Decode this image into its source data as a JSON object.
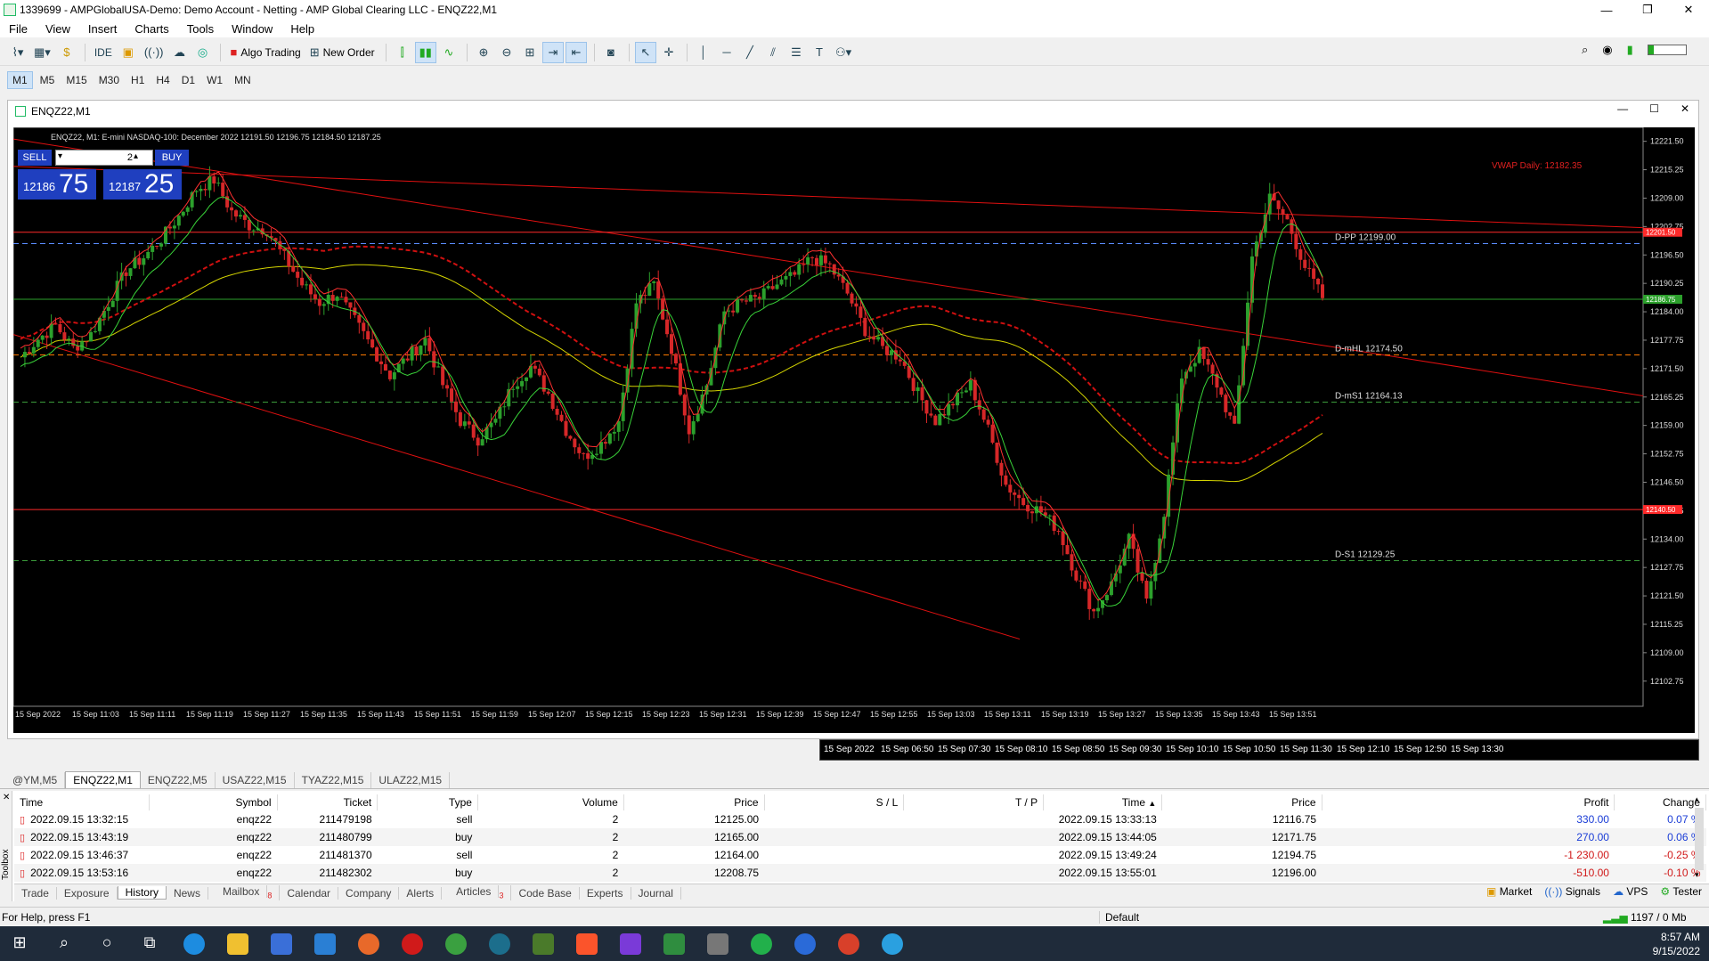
{
  "window": {
    "title": "1339699 - AMPGlobalUSA-Demo: Demo Account - Netting - AMP Global Clearing LLC - ENQZ22,M1",
    "minimize": "—",
    "restore": "❐",
    "close": "✕"
  },
  "menu": [
    "File",
    "View",
    "Insert",
    "Charts",
    "Tools",
    "Window",
    "Help"
  ],
  "toolbar": {
    "ide": "IDE",
    "algo_trading": "Algo Trading",
    "new_order": "New Order"
  },
  "timeframes": [
    "M1",
    "M5",
    "M15",
    "M30",
    "H1",
    "H4",
    "D1",
    "W1",
    "MN"
  ],
  "chart_window": {
    "title": "ENQZ22,M1",
    "header_text": "ENQZ22, M1: E-mini NASDAQ-100: December 2022  12191.50 12196.75 12184.50 12187.25"
  },
  "trade_panel": {
    "sell_label": "SELL",
    "buy_label": "BUY",
    "volume": "2",
    "sell_price_small": "12186",
    "sell_price_big": "75",
    "buy_price_small": "12187",
    "buy_price_big": "25"
  },
  "chart_data": {
    "type": "candlestick",
    "symbol": "ENQZ22",
    "timeframe": "M1",
    "ylim": [
      12098,
      12223
    ],
    "y_ticks": [
      12221.5,
      12215.25,
      12209.0,
      12202.75,
      12196.5,
      12190.25,
      12184.0,
      12177.75,
      12171.5,
      12165.25,
      12159.0,
      12152.75,
      12146.5,
      12140.25,
      12134.0,
      12127.75,
      12121.5,
      12115.25,
      12109.0,
      12102.75
    ],
    "y_tick_labels": [
      "12221.50",
      "12215.25",
      "12209.00",
      "12202.75",
      "12196.50",
      "12190.25",
      "12184.00",
      "12177.75",
      "12171.50",
      "12165.25",
      "12159.00",
      "12152.75",
      "12146.50",
      "12140.25",
      "12134.00",
      "12127.75",
      "12121.50",
      "12115.25",
      "12109.00",
      "12102.75"
    ],
    "x_tick_labels": [
      "15 Sep 2022",
      "15 Sep 11:03",
      "15 Sep 11:11",
      "15 Sep 11:19",
      "15 Sep 11:27",
      "15 Sep 11:35",
      "15 Sep 11:43",
      "15 Sep 11:51",
      "15 Sep 11:59",
      "15 Sep 12:07",
      "15 Sep 12:15",
      "15 Sep 12:23",
      "15 Sep 12:31",
      "15 Sep 12:39",
      "15 Sep 12:47",
      "15 Sep 12:55",
      "15 Sep 13:03",
      "15 Sep 13:11",
      "15 Sep 13:19",
      "15 Sep 13:27",
      "15 Sep 13:35",
      "15 Sep 13:43",
      "15 Sep 13:51"
    ],
    "close_path": [
      12174,
      12178,
      12181,
      12176,
      12179,
      12186,
      12193,
      12196,
      12200,
      12205,
      12211,
      12213,
      12206,
      12203,
      12202,
      12196,
      12190,
      12186,
      12188,
      12182,
      12176,
      12170,
      12174,
      12178,
      12168,
      12160,
      12156,
      12160,
      12168,
      12172,
      12166,
      12158,
      12152,
      12155,
      12160,
      12186,
      12190,
      12176,
      12158,
      12168,
      12184,
      12186,
      12187,
      12190,
      12192,
      12196,
      12194,
      12188,
      12180,
      12176,
      12174,
      12166,
      12160,
      12164,
      12168,
      12158,
      12146,
      12142,
      12140,
      12136,
      12126,
      12118,
      12124,
      12134,
      12120,
      12140,
      12170,
      12175,
      12168,
      12158,
      12196,
      12209,
      12204,
      12194,
      12187
    ],
    "levels": [
      {
        "label": "D-PP 12199.00",
        "value": 12199.0,
        "color": "#5a8cff",
        "dash": true
      },
      {
        "label": "D-mHL 12174.50",
        "value": 12174.5,
        "color": "#ff7a00",
        "dash": true
      },
      {
        "label": "D-mS1 12164.13",
        "value": 12164.13,
        "color": "#3a9a3a",
        "dash": true
      },
      {
        "label": "D-S1 12129.25",
        "value": 12129.25,
        "color": "#3a9a3a",
        "dash": true
      }
    ],
    "hlines": [
      {
        "value": 12201.5,
        "color": "#ff2a2a",
        "tag": "12201.50"
      },
      {
        "value": 12140.5,
        "color": "#ff2a2a",
        "tag": "12140.50"
      },
      {
        "value": 12186.75,
        "color": "#2ca02c",
        "tag": "12186.75"
      }
    ],
    "vwap_label": "VWAP Daily: 12182.35",
    "colors": {
      "up": "#2ca02c",
      "down": "#d62728",
      "ma_fast": "#ff3030",
      "ma_slow": "#39d339",
      "ma_yellow": "#d4d400",
      "vwap": "#d01010",
      "trend": "#e01010"
    }
  },
  "lower_axis": [
    "15 Sep 2022",
    "15 Sep 06:50",
    "15 Sep 07:30",
    "15 Sep 08:10",
    "15 Sep 08:50",
    "15 Sep 09:30",
    "15 Sep 10:10",
    "15 Sep 10:50",
    "15 Sep 11:30",
    "15 Sep 12:10",
    "15 Sep 12:50",
    "15 Sep 13:30"
  ],
  "chart_tabs": [
    "@YM,M5",
    "ENQZ22,M1",
    "ENQZ22,M5",
    "USAZ22,M15",
    "TYAZ22,M15",
    "ULAZ22,M15"
  ],
  "history": {
    "headers": [
      "Time",
      "Symbol",
      "Ticket",
      "Type",
      "Volume",
      "Price",
      "S / L",
      "T / P",
      "Time",
      "Price",
      "Profit",
      "Change"
    ],
    "rows": [
      [
        "2022.09.15 13:32:15",
        "enqz22",
        "211479198",
        "sell",
        "2",
        "12125.00",
        "",
        "",
        "2022.09.15 13:33:13",
        "12116.75",
        "330.00",
        "0.07 %"
      ],
      [
        "2022.09.15 13:43:19",
        "enqz22",
        "211480799",
        "buy",
        "2",
        "12165.00",
        "",
        "",
        "2022.09.15 13:44:05",
        "12171.75",
        "270.00",
        "0.06 %"
      ],
      [
        "2022.09.15 13:46:37",
        "enqz22",
        "211481370",
        "sell",
        "2",
        "12164.00",
        "",
        "",
        "2022.09.15 13:49:24",
        "12194.75",
        "-1 230.00",
        "-0.25 %"
      ],
      [
        "2022.09.15 13:53:16",
        "enqz22",
        "211482302",
        "buy",
        "2",
        "12208.75",
        "",
        "",
        "2022.09.15 13:55:01",
        "12196.00",
        "-510.00",
        "-0.10 %"
      ]
    ]
  },
  "toolbox_tabs": [
    "Trade",
    "Exposure",
    "History",
    "News",
    "Mailbox",
    "Calendar",
    "Company",
    "Alerts",
    "Articles",
    "Code Base",
    "Experts",
    "Journal"
  ],
  "toolbox_badges": {
    "mailbox": "8",
    "articles": "3"
  },
  "toolbox_right": [
    "Market",
    "Signals",
    "VPS",
    "Tester"
  ],
  "toolbox_label": "Toolbox",
  "status": {
    "help": "For Help, press F1",
    "profile": "Default",
    "traffic": "1197 / 0 Mb"
  },
  "taskbar": {
    "time": "8:57 AM",
    "date": "9/15/2022"
  }
}
